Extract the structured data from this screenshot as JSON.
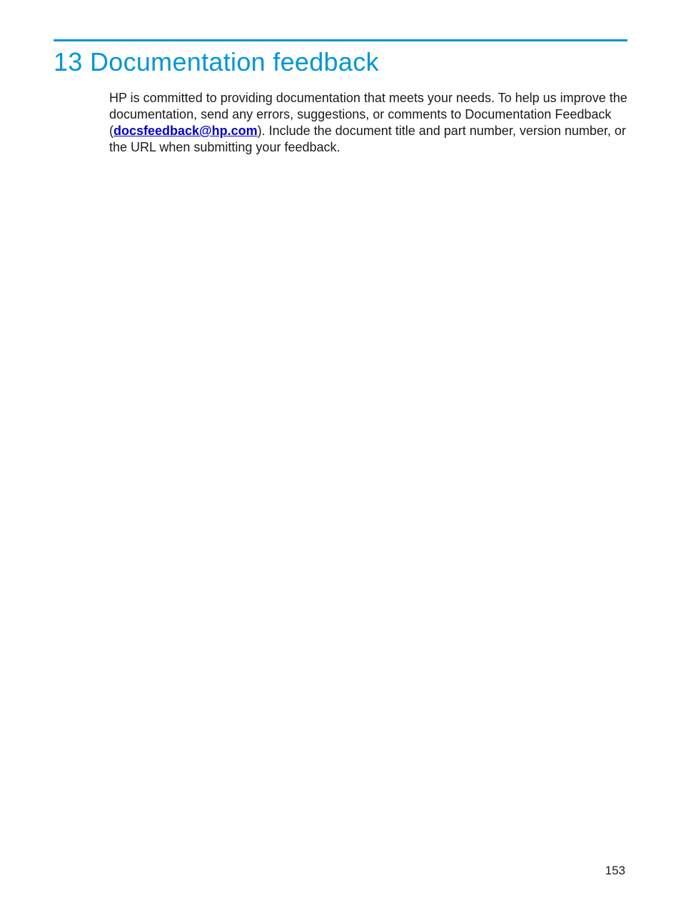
{
  "heading": "13 Documentation feedback",
  "paragraph": {
    "part1": "HP is committed to providing documentation that meets your needs. To help us improve the documentation, send any errors, suggestions, or comments to Documentation Feedback (",
    "email": "docsfeedback@hp.com",
    "part2": "). Include the document title and part number, version number, or the URL when submitting your feedback."
  },
  "page_number": "153"
}
